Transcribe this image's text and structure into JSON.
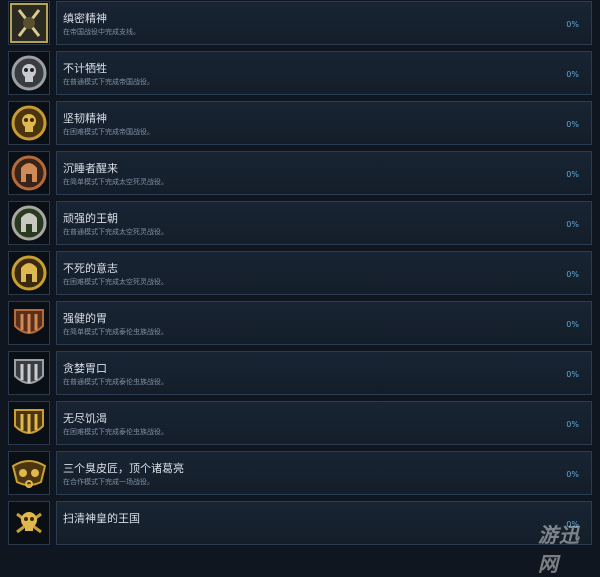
{
  "achievements": [
    {
      "title": "缜密精神",
      "desc": "在帝国战役中完成支线。",
      "pct": "0%",
      "icon": "crossed-swords-emblem-icon",
      "color": "#b7a25a"
    },
    {
      "title": "不计牺牲",
      "desc": "在普通模式下完成帝国战役。",
      "pct": "0%",
      "icon": "silver-skull-shield-icon",
      "color": "#9aa0a6"
    },
    {
      "title": "坚韧精神",
      "desc": "在困难模式下完成帝国战役。",
      "pct": "0%",
      "icon": "gold-skull-shield-icon",
      "color": "#c79a32"
    },
    {
      "title": "沉睡者醒来",
      "desc": "在简单模式下完成太空死灵战役。",
      "pct": "0%",
      "icon": "bronze-helmet-emblem-icon",
      "color": "#b56a3a"
    },
    {
      "title": "顽强的王朝",
      "desc": "在普通模式下完成太空死灵战役。",
      "pct": "0%",
      "icon": "silver-helmet-emblem-icon",
      "color": "#a8a8a0"
    },
    {
      "title": "不死的意志",
      "desc": "在困难模式下完成太空死灵战役。",
      "pct": "0%",
      "icon": "gold-helmet-emblem-icon",
      "color": "#c9a030"
    },
    {
      "title": "强健的胃",
      "desc": "在简单模式下完成泰伦虫族战役。",
      "pct": "0%",
      "icon": "bronze-claw-shield-icon",
      "color": "#b56a3a"
    },
    {
      "title": "贪婪胃口",
      "desc": "在普通模式下完成泰伦虫族战役。",
      "pct": "0%",
      "icon": "silver-claw-shield-icon",
      "color": "#9aa0a6"
    },
    {
      "title": "无尽饥渴",
      "desc": "在困难模式下完成泰伦虫族战役。",
      "pct": "0%",
      "icon": "gold-claw-shield-icon",
      "color": "#c9a030"
    },
    {
      "title": "三个臭皮匠，顶个诸葛亮",
      "desc": "在合作模式下完成一场战役。",
      "pct": "0%",
      "icon": "gold-chained-hands-icon",
      "color": "#c9a030"
    },
    {
      "title": "扫清神皇的王国",
      "desc": "",
      "pct": "0%",
      "icon": "gold-skull-crossbones-icon",
      "color": "#c9a030"
    }
  ],
  "watermark": "游迅网"
}
